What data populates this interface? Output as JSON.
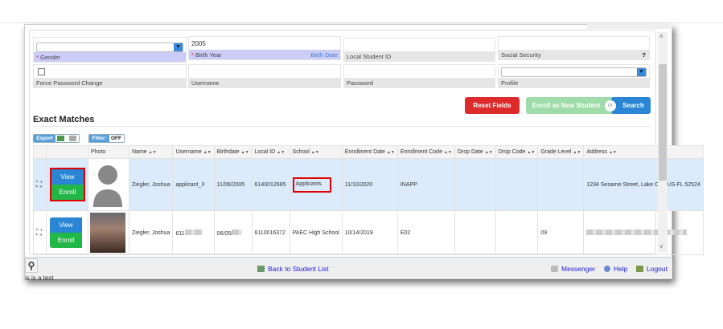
{
  "form": {
    "gender": {
      "label": "Gender",
      "value": ""
    },
    "birth_year": {
      "label": "Birth Year",
      "value": "2005",
      "link": "Birth Date"
    },
    "local_id": {
      "label": "Local Student ID",
      "value": ""
    },
    "ssn": {
      "label": "Social Security",
      "help": "?"
    },
    "force_pw": {
      "label": "Force Password Change",
      "checked": false
    },
    "username": {
      "label": "Username",
      "value": ""
    },
    "password": {
      "label": "Password",
      "value": ""
    },
    "profile": {
      "label": "Profile",
      "value": ""
    }
  },
  "buttons": {
    "reset": "Reset Fields",
    "enroll_new": "Enroll as New Student",
    "or": "or",
    "search": "Search"
  },
  "section_title": "Exact Matches",
  "toolbar": {
    "export": "Export",
    "filter": "Filter:",
    "filter_state": "OFF"
  },
  "table": {
    "headers": [
      "Photo",
      "Name",
      "Username",
      "Birthdate",
      "Local ID",
      "School",
      "Enrollment Date",
      "Enrollment Code",
      "Drop Date",
      "Drop Code",
      "Grade Level",
      "Address"
    ],
    "view_label": "View",
    "enroll_label": "Enroll",
    "rows": [
      {
        "name": "Ziegler, Joshua",
        "username": "applicant_3",
        "birthdate": "11/06/2005",
        "local_id": "6140012685",
        "school": "Applicants",
        "enroll_date": "11/10/2020",
        "enroll_code": "INAPP",
        "drop_date": "",
        "drop_code": "",
        "grade": "",
        "address": "1234 Sesame Street, Lake City, US-FL 52524"
      },
      {
        "name": "Ziegler, Joshua",
        "username": "611",
        "birthdate": "06/05/",
        "local_id": "6110016372",
        "school": "PAEC High School",
        "enroll_date": "10/14/2019",
        "enroll_code": "E02",
        "drop_date": "",
        "drop_code": "",
        "grade": "09",
        "address": ""
      }
    ]
  },
  "footer": {
    "back": "Back to Student List",
    "messenger": "Messenger",
    "help": "Help",
    "logout": "Logout",
    "status": "is is a test"
  },
  "colors": {
    "reset": "#dd2a2a",
    "enroll_new": "#9fdcaa",
    "search": "#2a86d4",
    "view": "#2a86d4",
    "enroll": "#22b848",
    "highlight": "#e00000"
  }
}
